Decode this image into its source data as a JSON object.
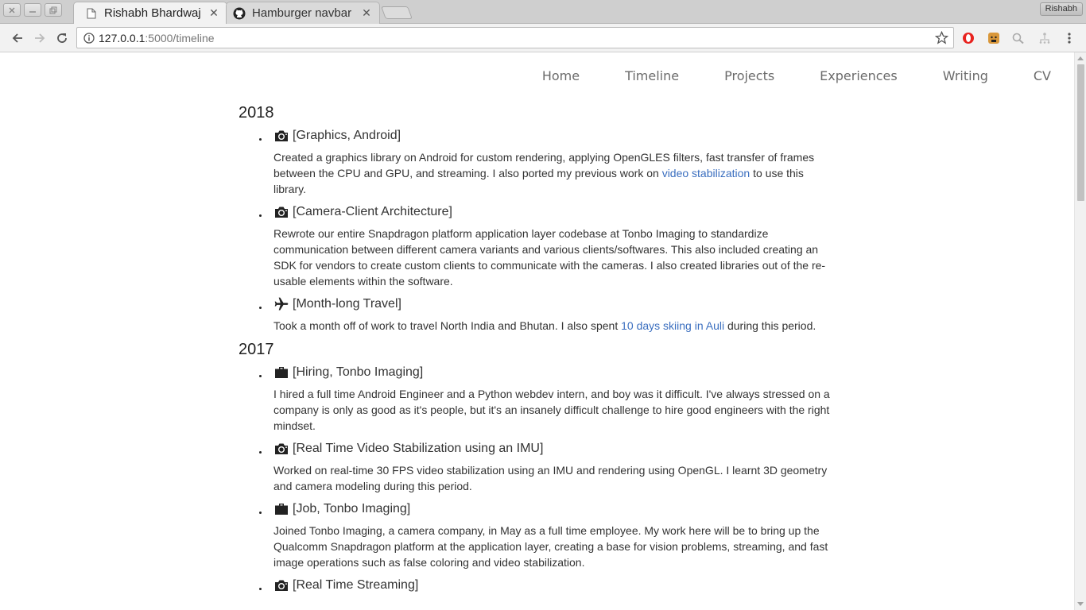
{
  "browser": {
    "tabs": [
      {
        "label": "Rishabh Bhardwaj",
        "active": true,
        "icon": "page-icon"
      },
      {
        "label": "Hamburger navbar",
        "active": false,
        "icon": "github-icon"
      }
    ],
    "profile_label": "Rishabh",
    "url_host": "127.0.0.1",
    "url_path": ":5000/timeline"
  },
  "site_nav": [
    "Home",
    "Timeline",
    "Projects",
    "Experiences",
    "Writing",
    "CV"
  ],
  "timeline": [
    {
      "year": "2018",
      "entries": [
        {
          "icon": "camera-icon",
          "title": "[Graphics, Android]",
          "desc_before": "Created a graphics library on Android for custom rendering, applying OpenGLES filters, fast transfer of frames between the CPU and GPU, and streaming. I also ported my previous work on ",
          "link": "video stabilization",
          "desc_after": " to use this library."
        },
        {
          "icon": "camera-icon",
          "title": "[Camera-Client Architecture]",
          "desc_before": "Rewrote our entire Snapdragon platform application layer codebase at Tonbo Imaging to standardize communication between different camera variants and various clients/softwares. This also included creating an SDK for vendors to create custom clients to communicate with the cameras. I also created libraries out of the re-usable elements within the software.",
          "link": "",
          "desc_after": ""
        },
        {
          "icon": "airplane-icon",
          "title": "[Month-long Travel]",
          "desc_before": "Took a month off of work to travel North India and Bhutan. I also spent ",
          "link": "10 days skiing in Auli",
          "desc_after": " during this period."
        }
      ]
    },
    {
      "year": "2017",
      "entries": [
        {
          "icon": "briefcase-icon",
          "title": "[Hiring, Tonbo Imaging]",
          "desc_before": "I hired a full time Android Engineer and a Python webdev intern, and boy was it difficult. I've always stressed on a company is only as good as it's people, but it's an insanely difficult challenge to hire good engineers with the right mindset.",
          "link": "",
          "desc_after": ""
        },
        {
          "icon": "camera-icon",
          "title": "[Real Time Video Stabilization using an IMU]",
          "desc_before": "Worked on real-time 30 FPS video stabilization using an IMU and rendering using OpenGL. I learnt 3D geometry and camera modeling during this period.",
          "link": "",
          "desc_after": ""
        },
        {
          "icon": "briefcase-icon",
          "title": "[Job, Tonbo Imaging]",
          "desc_before": "Joined Tonbo Imaging, a camera company, in May as a full time employee. My work here will be to bring up the Qualcomm Snapdragon platform at the application layer, creating a base for vision problems, streaming, and fast image operations such as false coloring and video stabilization.",
          "link": "",
          "desc_after": ""
        },
        {
          "icon": "camera-icon",
          "title": "[Real Time Streaming]",
          "desc_before": "",
          "link": "",
          "desc_after": ""
        }
      ]
    }
  ],
  "colors": {
    "link": "#3a6ebf",
    "text": "#333333",
    "nav": "#6b6b6b"
  }
}
